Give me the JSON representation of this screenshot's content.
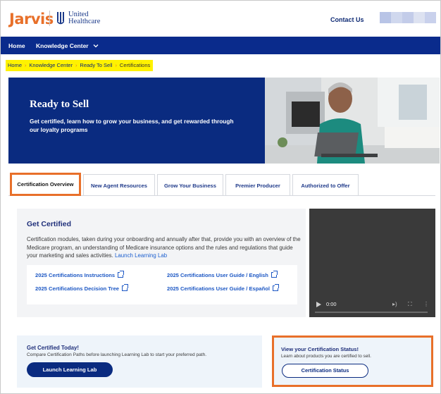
{
  "header": {
    "logo_text": "Jarvis",
    "partner_logo_line1": "United",
    "partner_logo_line2": "Healthcare",
    "contact_label": "Contact Us"
  },
  "nav": {
    "home_label": "Home",
    "knowledge_center_label": "Knowledge Center"
  },
  "breadcrumb": [
    "Home",
    "Knowledge Center",
    "Ready To Sell",
    "Certifications"
  ],
  "hero": {
    "title": "Ready to Sell",
    "subtitle": "Get certified, learn how to grow your business, and get rewarded through our loyalty programs"
  },
  "tabs": [
    {
      "label": "Certification Overview",
      "active": true
    },
    {
      "label": "New Agent Resources",
      "active": false
    },
    {
      "label": "Grow Your Business",
      "active": false
    },
    {
      "label": "Premier Producer",
      "active": false
    },
    {
      "label": "Authorized to Offer",
      "active": false
    }
  ],
  "get_certified": {
    "title": "Get Certified",
    "description": "Certification modules, taken during your onboarding and annually after that, provide you with an overview of the Medicare program, an understanding of Medicare insurance options and the rules and regulations that guide your marketing and sales activities.",
    "link_label": "Launch Learning Lab",
    "links": [
      "2025 Certifications Instructions",
      "2025 Certifications User Guide / English",
      "2025 Certifications Decision Tree",
      "2025 Certifications User Guide / Español"
    ]
  },
  "video": {
    "time": "0:00"
  },
  "cta_left": {
    "title": "Get Certified Today!",
    "text": "Compare Certification Paths before launching Learning Lab to start your preferred path.",
    "button": "Launch Learning Lab"
  },
  "cta_right": {
    "title": "View your Certification Status!",
    "text": "Learn about products you are certified to sell.",
    "button": "Certification Status"
  },
  "colors": {
    "brand_navy": "#0a2b8c",
    "accent_orange": "#e8702a",
    "breadcrumb_highlight": "#fff200"
  }
}
